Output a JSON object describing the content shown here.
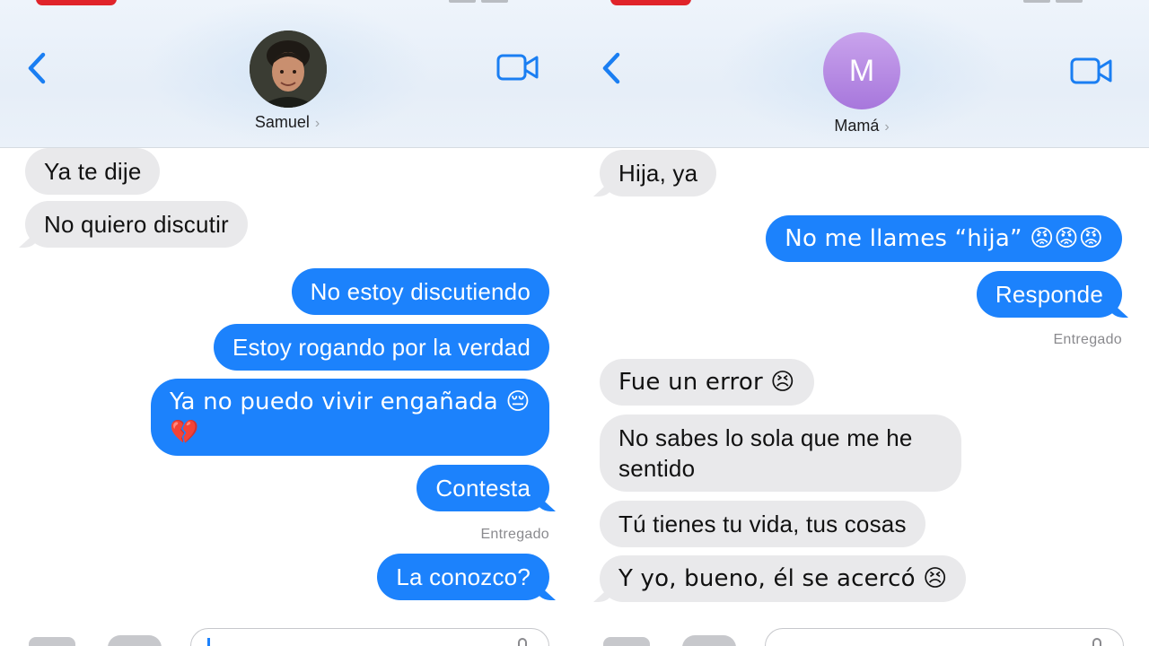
{
  "left": {
    "contact_name": "Samuel",
    "chevron": "›",
    "messages": [
      {
        "text": "Ya te dije",
        "type": "received"
      },
      {
        "text": "No quiero discutir",
        "type": "received"
      },
      {
        "text": "No estoy discutiendo",
        "type": "sent"
      },
      {
        "text": "Estoy rogando por la verdad",
        "type": "sent"
      },
      {
        "text": "Ya no puedo vivir engañada 😔\n💔",
        "type": "sent"
      },
      {
        "text": "Contesta",
        "type": "sent"
      },
      {
        "text": "La conozco?",
        "type": "sent"
      }
    ],
    "delivered_label": "Entregado"
  },
  "right": {
    "contact_name": "Mamá",
    "avatar_initial": "M",
    "chevron": "›",
    "messages": [
      {
        "text": "Hija, ya",
        "type": "received"
      },
      {
        "text": "No me llames “hija” 😡😡😡",
        "type": "sent"
      },
      {
        "text": "Responde",
        "type": "sent"
      },
      {
        "text": "Fue un error 😣",
        "type": "received"
      },
      {
        "text": "No sabes lo sola que me he\nsentido",
        "type": "received"
      },
      {
        "text": "Tú tienes tu vida, tus cosas",
        "type": "received"
      },
      {
        "text": "Y yo, bueno, él se acercó 😣",
        "type": "received"
      }
    ],
    "delivered_label": "Entregado"
  },
  "icons": {
    "back": "chevron-left-icon",
    "video": "video-camera-icon",
    "camera": "camera-icon",
    "apps": "app-store-icon",
    "mic": "microphone-icon"
  },
  "colors": {
    "sent_bubble": "#1c82fc",
    "received_bubble": "#e9e9eb",
    "accent": "#1a7ef2",
    "status_red": "#e0242a"
  }
}
